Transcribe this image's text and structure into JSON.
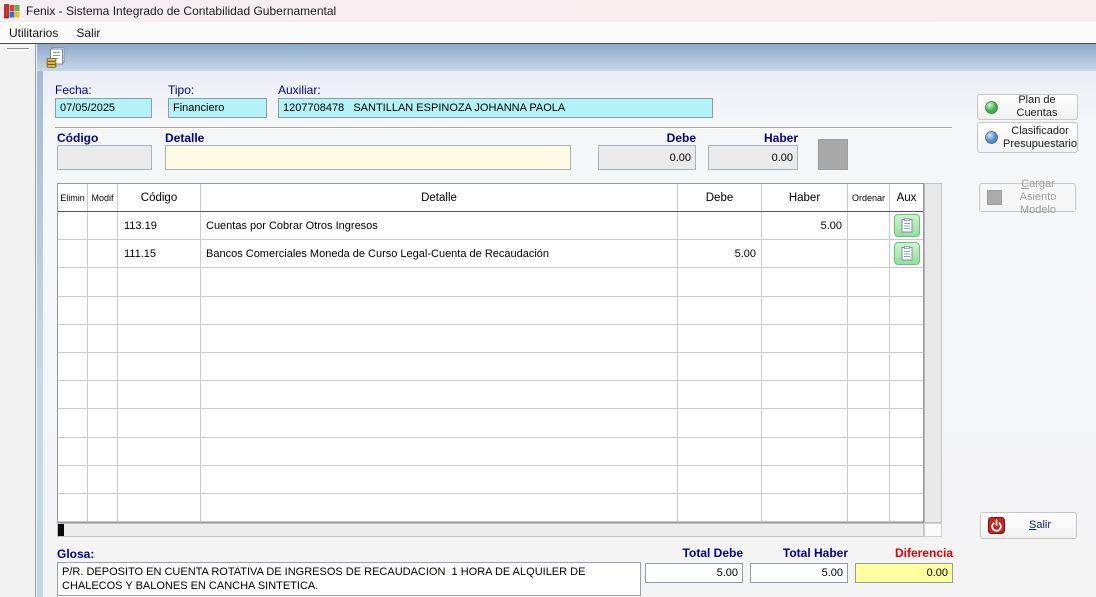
{
  "window": {
    "title": "Fenix - Sistema Integrado de Contabilidad Gubernamental"
  },
  "menu": {
    "items": [
      {
        "label": "Utilitarios"
      },
      {
        "label": "Salir"
      }
    ]
  },
  "toolbar": {
    "new_entry_icon": "journal-document-icon"
  },
  "form": {
    "fecha_label": "Fecha:",
    "fecha_value": "07/05/2025",
    "tipo_label": "Tipo:",
    "tipo_value": "Financiero",
    "auxiliar_label": "Auxiliar:",
    "auxiliar_value": "1207708478   SANTILLAN ESPINOZA JOHANNA PAOLA",
    "entry": {
      "codigo_label": "Código",
      "detalle_label": "Detalle",
      "debe_label": "Debe",
      "haber_label": "Haber",
      "codigo_value": "",
      "detalle_value": "",
      "debe_value": "0.00",
      "haber_value": "0.00"
    }
  },
  "table": {
    "headers": [
      "Elimin",
      "Modif",
      "Código",
      "Detalle",
      "Debe",
      "Haber",
      "Ordenar",
      "Aux"
    ],
    "rows": [
      {
        "elimin": "",
        "modif": "",
        "codigo": "113.19",
        "detalle": "Cuentas por Cobrar Otros Ingresos",
        "debe": "",
        "haber": "5.00",
        "ordenar": ""
      },
      {
        "elimin": "",
        "modif": "",
        "codigo": "111.15",
        "detalle": "Bancos Comerciales Moneda de Curso Legal-Cuenta de Recaudación",
        "debe": "5.00",
        "haber": "",
        "ordenar": ""
      }
    ],
    "empty_rows": 9
  },
  "side": {
    "plan_cuentas_label": "Plan de Cuentas",
    "clasificador_label_line1": "Clasificador",
    "clasificador_label_line2": "Presupuestario",
    "cargar_label_line1": "Cargar Asiento",
    "cargar_label_line2": "Modelo",
    "salir_label": "Salir"
  },
  "footer": {
    "glosa_label": "Glosa:",
    "glosa_value": "P/R. DEPOSITO EN CUENTA ROTATIVA DE INGRESOS DE RECAUDACION  1 HORA DE ALQUILER DE CHALECOS Y BALONES EN CANCHA SINTETICA.",
    "total_debe_label": "Total Debe",
    "total_debe_value": "5.00",
    "total_haber_label": "Total Haber",
    "total_haber_value": "5.00",
    "diferencia_label": "Diferencia",
    "diferencia_value": "0.00"
  },
  "colors": {
    "label_navy": "#00008B",
    "diferencia_red": "#E00000",
    "field_cyan": "#B3F2F7",
    "field_yellow": "#FBFAE2",
    "field_disabled": "#EAEAEA",
    "diferencia_bg": "#FFFF9E",
    "toolbar_top": "#8FA9C9",
    "toolbar_bottom": "#C6D6E9",
    "aux_button_green": "#93E09C",
    "plan_icon_green": "#3FAE49",
    "clasificador_icon_blue": "#4E8BC9",
    "salir_icon_red": "#C5271C"
  }
}
